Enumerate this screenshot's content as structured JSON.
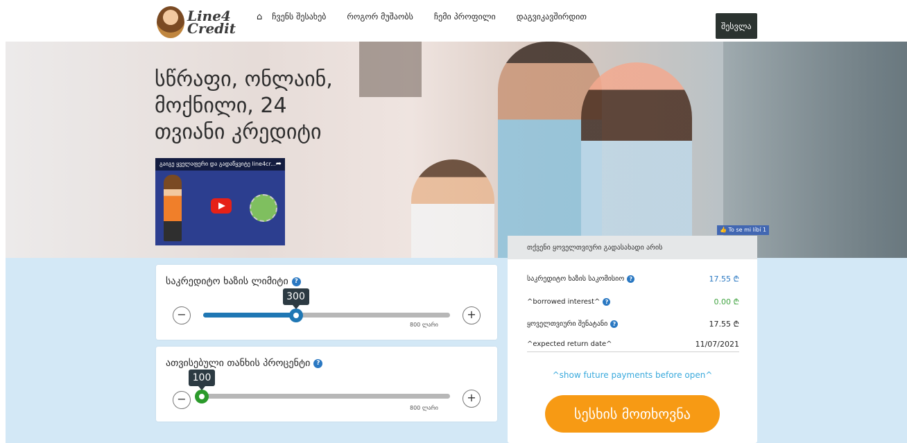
{
  "brand": {
    "logo_line1": "Line4",
    "logo_line2": "Credit"
  },
  "nav": {
    "home_icon": "home-icon",
    "items": [
      {
        "label": "ჩვენს შესახებ"
      },
      {
        "label": "როგორ მუშაობს"
      },
      {
        "label": "ჩემი პროფილი"
      },
      {
        "label": "დაგვიკავშირდით"
      }
    ],
    "login_label": "შესვლა"
  },
  "hero": {
    "line1": "სწრაფი, ონლაინ,",
    "line2": "მოქნილი, 24",
    "line3": "თვიანი კრედიტი"
  },
  "video": {
    "title": "გაიგე ყველაფერი და გადაწყვიტე line4cr..."
  },
  "like_badge": "To se mi líbí 1",
  "limit_card": {
    "title": "საკრედიტო ხაზის ლიმიტი",
    "value": "300",
    "max_label": "800 ლარი",
    "fraction": 0.375,
    "accent": "#1f77b4"
  },
  "percent_card": {
    "title": "ათვისებული თანხის პროცენტი",
    "value": "100",
    "max_label": "800 ლარი",
    "fraction": 0.0,
    "accent": "#2b9a2b"
  },
  "summary": {
    "header": "თქვენი ყოველთვიური გადასახადი არის",
    "rows": [
      {
        "label": "საკრედიტო ხაზის საკომისიო",
        "value": "17.55 ₾",
        "color": "#2a78c2",
        "help": true
      },
      {
        "label": "^borrowed interest^",
        "value": "0.00 ₾",
        "color": "#3fa33f",
        "help": true
      },
      {
        "label": "ყოველთვიური შენატანი",
        "value": "17.55 ₾",
        "color": "#222222",
        "help": true
      },
      {
        "label": "^expected return date^",
        "value": "11/07/2021",
        "color": "#222222",
        "help": false
      }
    ],
    "future_link": "^show future payments before open^",
    "request_button": "სესხის მოთხოვნა"
  }
}
